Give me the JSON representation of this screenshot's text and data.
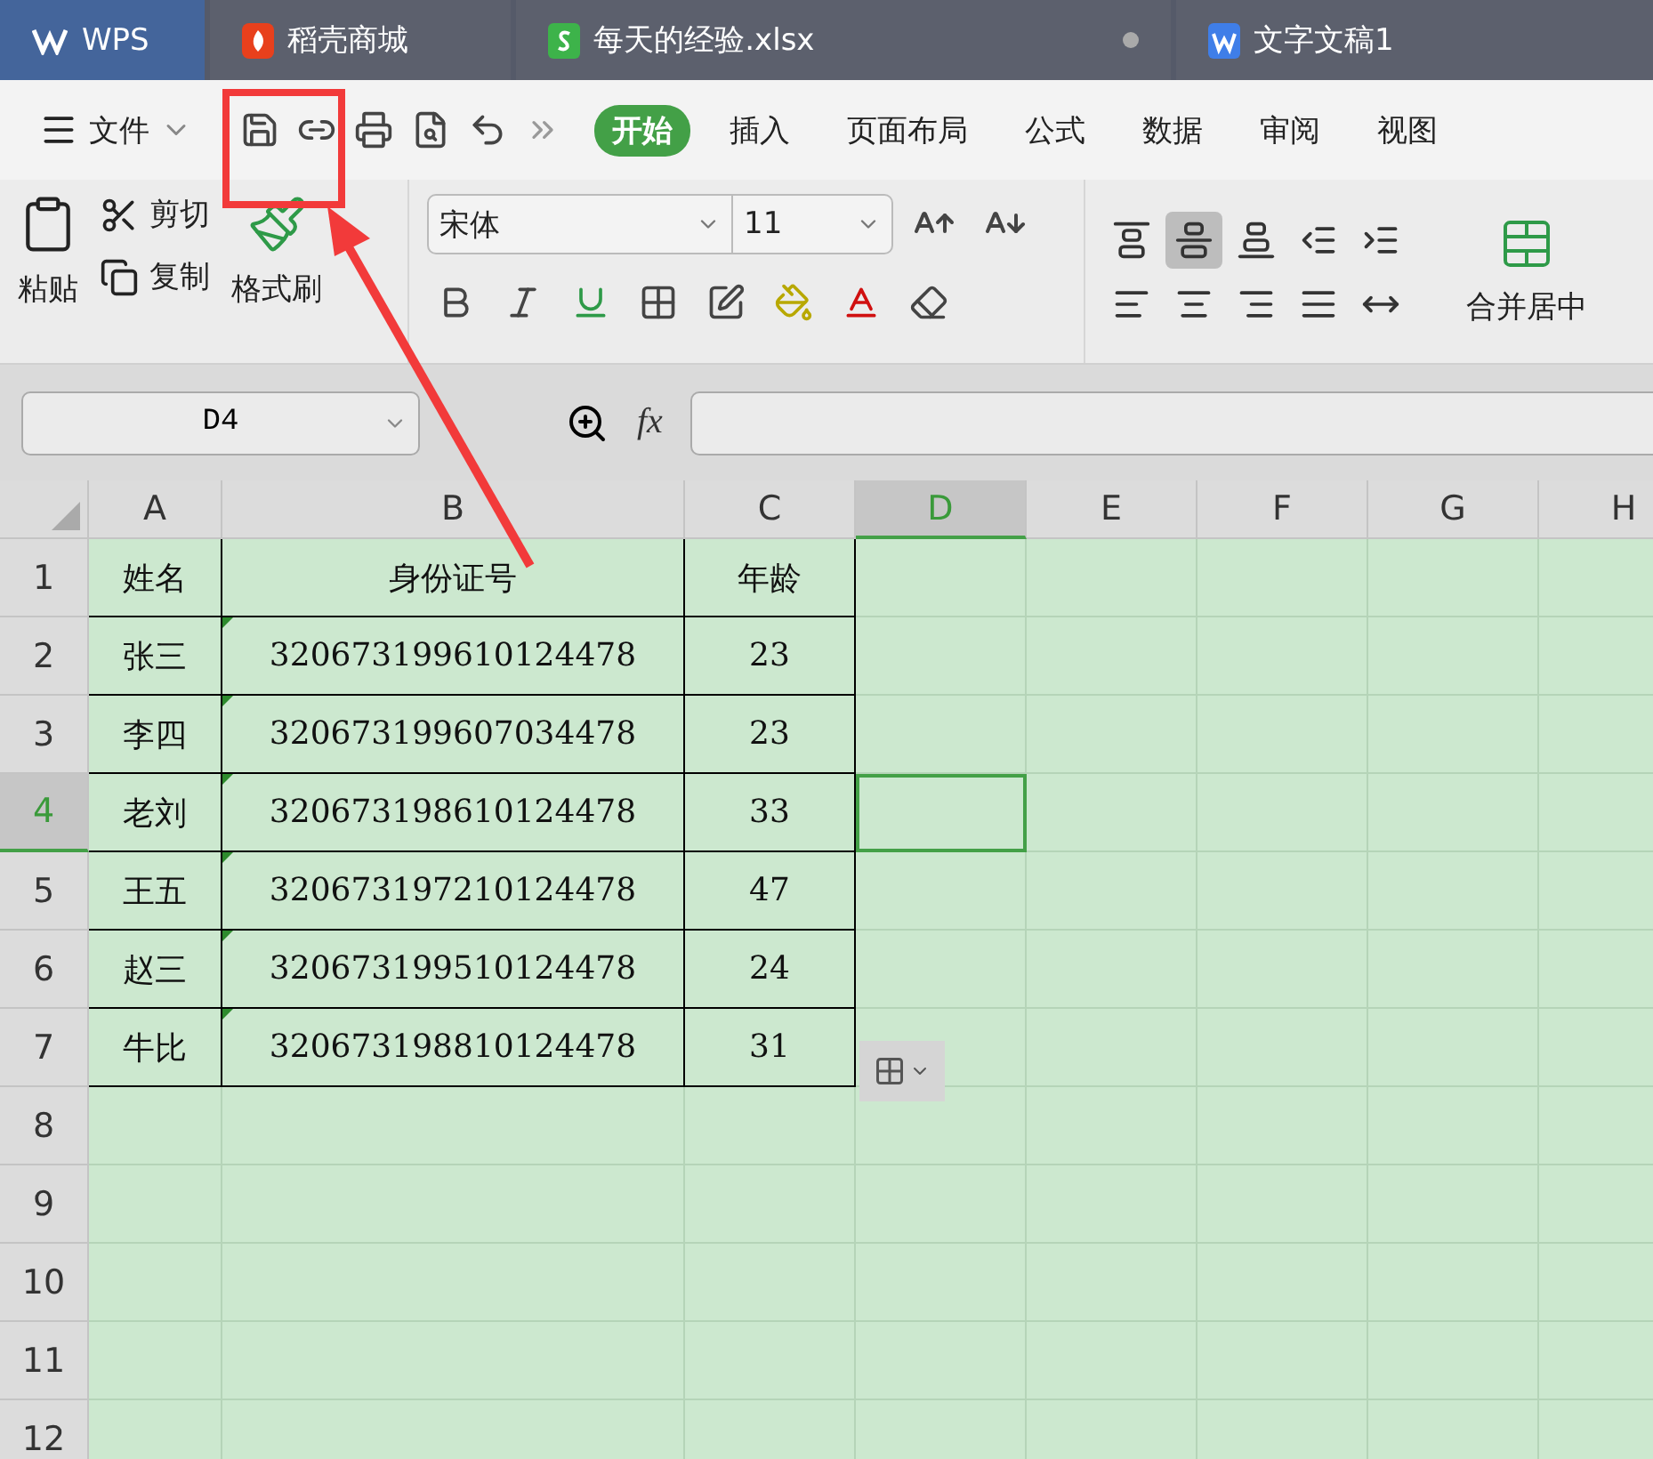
{
  "app_tabs": [
    {
      "kind": "home",
      "label": "WPS",
      "selected": true
    },
    {
      "kind": "store",
      "label": "稻壳商城",
      "selected": false
    },
    {
      "kind": "sheet",
      "label": "每天的经验.xlsx",
      "selected": false,
      "unsaved": true
    },
    {
      "kind": "doc",
      "label": "文字文稿1",
      "selected": false
    }
  ],
  "file_menu": "文件",
  "ribbon_tabs": [
    {
      "label": "开始",
      "selected": true
    },
    {
      "label": "插入",
      "selected": false
    },
    {
      "label": "页面布局",
      "selected": false
    },
    {
      "label": "公式",
      "selected": false
    },
    {
      "label": "数据",
      "selected": false
    },
    {
      "label": "审阅",
      "selected": false
    },
    {
      "label": "视图",
      "selected": false
    }
  ],
  "clipboard": {
    "paste": "粘贴",
    "cut": "剪切",
    "copy": "复制",
    "format_painter": "格式刷"
  },
  "font": {
    "name": "宋体",
    "size": "11"
  },
  "alignment": [
    {
      "kind": "top",
      "selected": false
    },
    {
      "kind": "middle",
      "selected": true
    },
    {
      "kind": "bottom",
      "selected": false
    },
    {
      "kind": "outdent",
      "selected": false
    },
    {
      "kind": "indent",
      "selected": false
    },
    {
      "kind": "left",
      "selected": false
    },
    {
      "kind": "center",
      "selected": false
    },
    {
      "kind": "right",
      "selected": false
    },
    {
      "kind": "justify",
      "selected": false
    },
    {
      "kind": "distributed",
      "selected": false
    }
  ],
  "merge_label": "合并居中",
  "name_box": "D4",
  "fx_label": "fx",
  "columns": [
    {
      "label": "A",
      "selected": false
    },
    {
      "label": "B",
      "selected": false
    },
    {
      "label": "C",
      "selected": false
    },
    {
      "label": "D",
      "selected": true
    },
    {
      "label": "E",
      "selected": false
    },
    {
      "label": "F",
      "selected": false
    },
    {
      "label": "G",
      "selected": false
    },
    {
      "label": "H",
      "selected": false
    }
  ],
  "rows": [
    {
      "number": "1",
      "selected": false,
      "cells": [
        {
          "text": "姓名",
          "flag": false
        },
        {
          "text": "身份证号",
          "flag": false
        },
        {
          "text": "年龄",
          "flag": false
        }
      ]
    },
    {
      "number": "2",
      "selected": false,
      "cells": [
        {
          "text": "张三",
          "flag": false
        },
        {
          "text": "320673199610124478",
          "flag": true
        },
        {
          "text": "23",
          "flag": false
        }
      ]
    },
    {
      "number": "3",
      "selected": false,
      "cells": [
        {
          "text": "李四",
          "flag": false
        },
        {
          "text": "320673199607034478",
          "flag": true
        },
        {
          "text": "23",
          "flag": false
        }
      ]
    },
    {
      "number": "4",
      "selected": true,
      "cells": [
        {
          "text": "老刘",
          "flag": false
        },
        {
          "text": "320673198610124478",
          "flag": true
        },
        {
          "text": "33",
          "flag": false
        }
      ]
    },
    {
      "number": "5",
      "selected": false,
      "cells": [
        {
          "text": "王五",
          "flag": false
        },
        {
          "text": "320673197210124478",
          "flag": true
        },
        {
          "text": "47",
          "flag": false
        }
      ]
    },
    {
      "number": "6",
      "selected": false,
      "cells": [
        {
          "text": "赵三",
          "flag": false
        },
        {
          "text": "320673199510124478",
          "flag": true
        },
        {
          "text": "24",
          "flag": false
        }
      ]
    },
    {
      "number": "7",
      "selected": false,
      "cells": [
        {
          "text": "牛比",
          "flag": false
        },
        {
          "text": "320673198810124478",
          "flag": true
        },
        {
          "text": "31",
          "flag": false
        }
      ]
    },
    {
      "number": "8",
      "selected": false,
      "cells": []
    },
    {
      "number": "9",
      "selected": false,
      "cells": []
    },
    {
      "number": "10",
      "selected": false,
      "cells": []
    },
    {
      "number": "11",
      "selected": false,
      "cells": []
    },
    {
      "number": "12",
      "selected": false,
      "cells": []
    }
  ]
}
